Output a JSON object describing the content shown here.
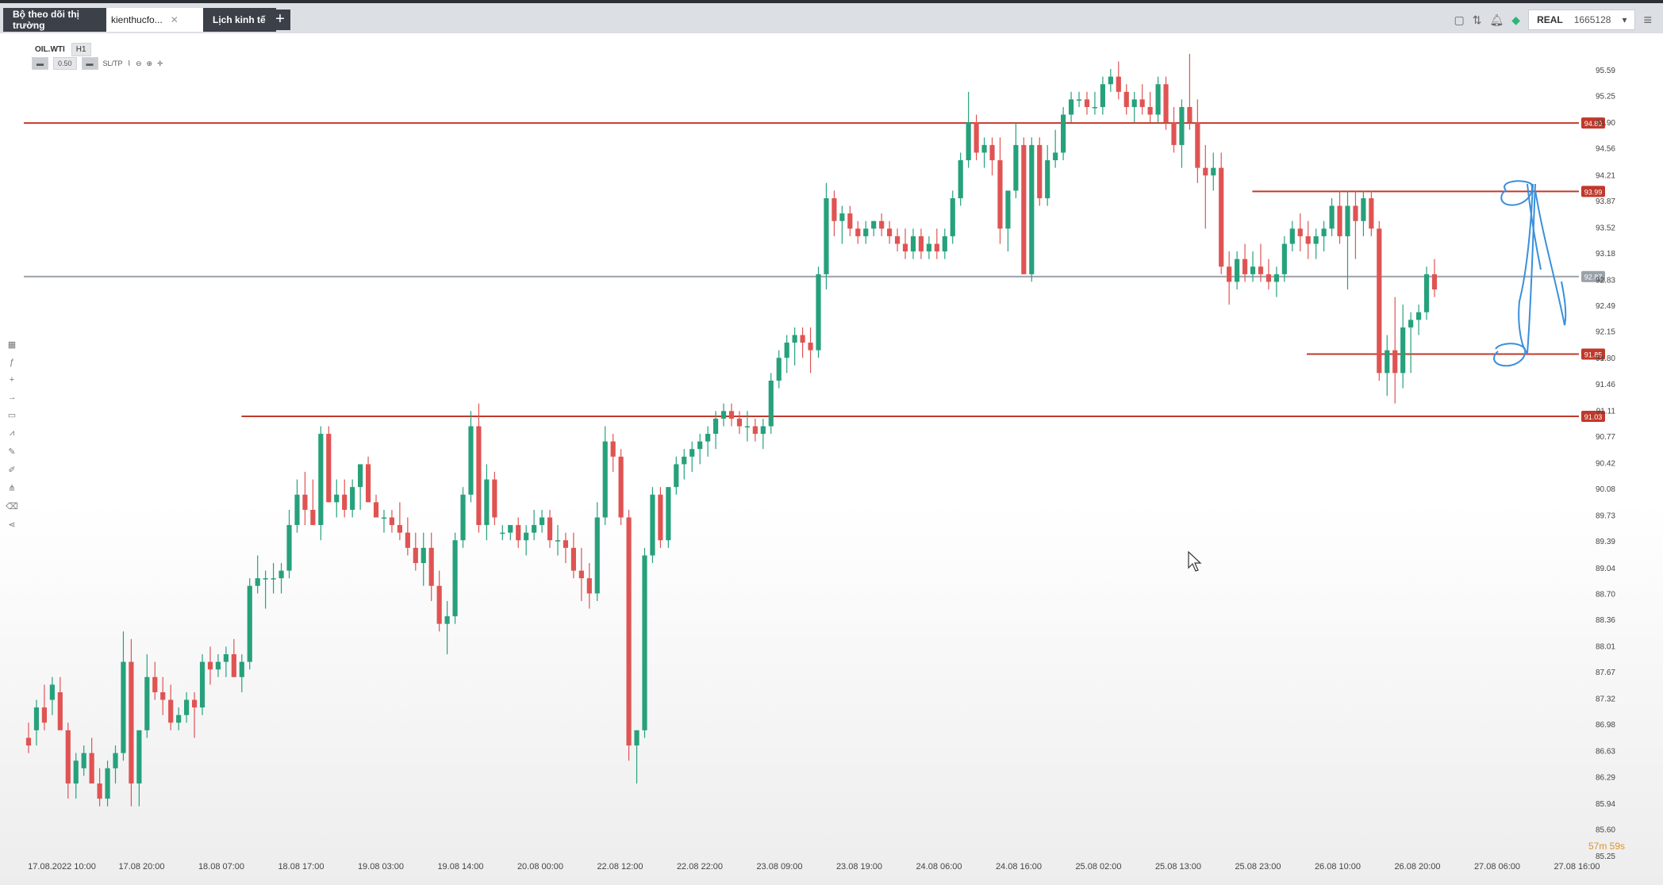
{
  "tabs": [
    {
      "label": "Bộ theo dõi thị trường",
      "kind": "dark"
    },
    {
      "label": "kienthucfo...",
      "kind": "light"
    },
    {
      "label": "Lịch kinh tế",
      "kind": "dark"
    }
  ],
  "account": {
    "mode": "REAL",
    "number": "1665128"
  },
  "symbol": {
    "name": "OIL.WTI",
    "timeframe": "H1",
    "volume": "0.50",
    "sltp": "SL/TP"
  },
  "timer": "57m 59s",
  "chart_data": {
    "type": "candlestick",
    "ylim": [
      85.25,
      95.59
    ],
    "price_ticks": [
      "95.59",
      "95.25",
      "94.90",
      "94.56",
      "94.21",
      "93.87",
      "93.52",
      "93.18",
      "92.83",
      "92.49",
      "92.15",
      "91.80",
      "91.46",
      "91.11",
      "90.77",
      "90.42",
      "90.08",
      "89.73",
      "89.39",
      "89.04",
      "88.70",
      "88.36",
      "88.01",
      "87.67",
      "87.32",
      "86.98",
      "86.63",
      "86.29",
      "85.94",
      "85.60",
      "85.25"
    ],
    "time_labels": [
      "17.08.2022 10:00",
      "17.08 20:00",
      "18.08 07:00",
      "18.08 17:00",
      "19.08 03:00",
      "19.08 14:00",
      "20.08 00:00",
      "22.08 12:00",
      "22.08 22:00",
      "23.08 09:00",
      "23.08 19:00",
      "24.08 06:00",
      "24.08 16:00",
      "25.08 02:00",
      "25.08 13:00",
      "25.08 23:00",
      "26.08 10:00",
      "26.08 20:00",
      "27.08 06:00",
      "27.08 16:00"
    ],
    "levels": [
      {
        "price": 94.89,
        "label": "94.89",
        "color": "#c0392b",
        "start": 0.0
      },
      {
        "price": 93.99,
        "label": "93.99",
        "color": "#c0392b",
        "start": 0.79
      },
      {
        "price": 92.87,
        "label": "92.87",
        "color": "#9aa1a9",
        "start": 0.0
      },
      {
        "price": 91.85,
        "label": "91.85",
        "color": "#c0392b",
        "start": 0.825
      },
      {
        "price": 91.03,
        "label": "91.03",
        "color": "#c0392b",
        "start": 0.14
      }
    ],
    "up_color": "#26a17b",
    "down_color": "#e05353",
    "candles": [
      [
        86.8,
        87.0,
        86.6,
        86.7
      ],
      [
        86.9,
        87.3,
        86.7,
        87.2
      ],
      [
        87.2,
        87.5,
        86.9,
        87.0
      ],
      [
        87.3,
        87.6,
        87.1,
        87.5
      ],
      [
        87.4,
        87.6,
        87.0,
        86.9
      ],
      [
        86.9,
        87.0,
        86.0,
        86.2
      ],
      [
        86.2,
        86.6,
        86.0,
        86.5
      ],
      [
        86.4,
        86.7,
        86.3,
        86.6
      ],
      [
        86.6,
        86.8,
        86.2,
        86.2
      ],
      [
        86.2,
        86.4,
        85.9,
        86.0
      ],
      [
        86.0,
        86.5,
        85.9,
        86.4
      ],
      [
        86.4,
        86.7,
        86.2,
        86.6
      ],
      [
        86.6,
        88.2,
        86.5,
        87.8
      ],
      [
        87.8,
        88.1,
        85.9,
        86.2
      ],
      [
        86.2,
        86.9,
        85.9,
        86.9
      ],
      [
        86.9,
        87.9,
        86.8,
        87.6
      ],
      [
        87.6,
        87.8,
        87.3,
        87.4
      ],
      [
        87.4,
        87.6,
        87.1,
        87.3
      ],
      [
        87.3,
        87.5,
        86.9,
        87.0
      ],
      [
        87.0,
        87.2,
        86.9,
        87.1
      ],
      [
        87.1,
        87.4,
        87.0,
        87.3
      ],
      [
        87.3,
        87.4,
        86.8,
        87.2
      ],
      [
        87.2,
        87.9,
        87.1,
        87.8
      ],
      [
        87.8,
        88.0,
        87.5,
        87.7
      ],
      [
        87.7,
        87.9,
        87.6,
        87.8
      ],
      [
        87.8,
        88.0,
        87.6,
        87.9
      ],
      [
        87.9,
        88.1,
        87.6,
        87.6
      ],
      [
        87.6,
        87.9,
        87.4,
        87.8
      ],
      [
        87.8,
        88.9,
        87.7,
        88.8
      ],
      [
        88.8,
        89.2,
        88.7,
        88.9
      ],
      [
        88.9,
        89.0,
        88.5,
        88.9
      ],
      [
        88.9,
        89.1,
        88.7,
        88.9
      ],
      [
        88.9,
        89.1,
        88.7,
        89.0
      ],
      [
        89.0,
        89.8,
        88.9,
        89.6
      ],
      [
        89.6,
        90.2,
        89.5,
        90.0
      ],
      [
        90.0,
        90.3,
        89.6,
        89.8
      ],
      [
        89.8,
        90.2,
        89.6,
        89.6
      ],
      [
        89.6,
        90.9,
        89.4,
        90.8
      ],
      [
        90.8,
        90.9,
        89.9,
        89.9
      ],
      [
        89.9,
        90.2,
        89.7,
        90.0
      ],
      [
        90.0,
        90.2,
        89.7,
        89.8
      ],
      [
        89.8,
        90.2,
        89.7,
        90.1
      ],
      [
        90.1,
        90.4,
        89.8,
        90.4
      ],
      [
        90.4,
        90.5,
        89.9,
        89.9
      ],
      [
        89.9,
        90.0,
        89.7,
        89.7
      ],
      [
        89.7,
        89.8,
        89.5,
        89.7
      ],
      [
        89.7,
        89.8,
        89.5,
        89.6
      ],
      [
        89.6,
        89.9,
        89.4,
        89.5
      ],
      [
        89.5,
        89.7,
        89.2,
        89.3
      ],
      [
        89.3,
        89.5,
        89.0,
        89.1
      ],
      [
        89.1,
        89.5,
        88.8,
        89.3
      ],
      [
        89.3,
        89.5,
        88.6,
        88.8
      ],
      [
        88.8,
        89.0,
        88.2,
        88.3
      ],
      [
        88.3,
        88.6,
        87.9,
        88.4
      ],
      [
        88.4,
        89.5,
        88.3,
        89.4
      ],
      [
        89.4,
        90.1,
        89.3,
        90.0
      ],
      [
        90.0,
        91.1,
        89.9,
        90.9
      ],
      [
        90.9,
        91.2,
        89.5,
        89.6
      ],
      [
        89.6,
        90.4,
        89.4,
        90.2
      ],
      [
        90.2,
        90.3,
        89.6,
        89.7
      ],
      [
        89.5,
        89.6,
        89.4,
        89.5
      ],
      [
        89.5,
        89.6,
        89.4,
        89.6
      ],
      [
        89.6,
        89.7,
        89.3,
        89.4
      ],
      [
        89.4,
        89.6,
        89.2,
        89.5
      ],
      [
        89.5,
        89.8,
        89.4,
        89.6
      ],
      [
        89.6,
        89.8,
        89.5,
        89.7
      ],
      [
        89.7,
        89.8,
        89.3,
        89.4
      ],
      [
        89.4,
        89.6,
        89.2,
        89.4
      ],
      [
        89.4,
        89.5,
        89.1,
        89.3
      ],
      [
        89.3,
        89.5,
        88.9,
        89.0
      ],
      [
        89.0,
        89.3,
        88.6,
        88.9
      ],
      [
        88.9,
        89.1,
        88.5,
        88.7
      ],
      [
        88.7,
        89.9,
        88.6,
        89.7
      ],
      [
        89.7,
        90.9,
        89.6,
        90.7
      ],
      [
        90.7,
        90.8,
        90.3,
        90.5
      ],
      [
        90.5,
        90.6,
        89.6,
        89.7
      ],
      [
        89.7,
        89.8,
        86.5,
        86.7
      ],
      [
        86.7,
        86.9,
        86.2,
        86.9
      ],
      [
        86.9,
        89.3,
        86.8,
        89.2
      ],
      [
        89.2,
        90.1,
        89.1,
        90.0
      ],
      [
        90.0,
        90.1,
        89.3,
        89.4
      ],
      [
        89.4,
        90.1,
        89.3,
        90.1
      ],
      [
        90.1,
        90.5,
        90.0,
        90.4
      ],
      [
        90.4,
        90.6,
        90.2,
        90.5
      ],
      [
        90.5,
        90.7,
        90.3,
        90.6
      ],
      [
        90.6,
        90.8,
        90.4,
        90.7
      ],
      [
        90.7,
        90.9,
        90.5,
        90.8
      ],
      [
        90.8,
        91.1,
        90.6,
        91.0
      ],
      [
        91.0,
        91.2,
        90.9,
        91.1
      ],
      [
        91.1,
        91.2,
        90.9,
        91.0
      ],
      [
        91.0,
        91.1,
        90.8,
        90.9
      ],
      [
        90.9,
        91.1,
        90.7,
        90.9
      ],
      [
        90.9,
        91.0,
        90.7,
        90.8
      ],
      [
        90.8,
        91.0,
        90.6,
        90.9
      ],
      [
        90.9,
        91.6,
        90.8,
        91.5
      ],
      [
        91.5,
        91.9,
        91.4,
        91.8
      ],
      [
        91.8,
        92.1,
        91.6,
        92.0
      ],
      [
        92.0,
        92.2,
        91.7,
        92.1
      ],
      [
        92.1,
        92.2,
        91.8,
        92.0
      ],
      [
        92.0,
        92.2,
        91.6,
        91.9
      ],
      [
        91.9,
        93.0,
        91.8,
        92.9
      ],
      [
        92.9,
        94.1,
        92.7,
        93.9
      ],
      [
        93.9,
        94.0,
        93.4,
        93.6
      ],
      [
        93.6,
        93.8,
        93.3,
        93.7
      ],
      [
        93.7,
        93.8,
        93.4,
        93.5
      ],
      [
        93.5,
        93.6,
        93.3,
        93.4
      ],
      [
        93.4,
        93.6,
        93.3,
        93.5
      ],
      [
        93.5,
        93.6,
        93.4,
        93.6
      ],
      [
        93.6,
        93.7,
        93.4,
        93.5
      ],
      [
        93.5,
        93.6,
        93.3,
        93.4
      ],
      [
        93.4,
        93.5,
        93.2,
        93.3
      ],
      [
        93.3,
        93.5,
        93.1,
        93.2
      ],
      [
        93.2,
        93.5,
        93.1,
        93.4
      ],
      [
        93.4,
        93.5,
        93.1,
        93.2
      ],
      [
        93.2,
        93.4,
        93.1,
        93.3
      ],
      [
        93.3,
        93.5,
        93.1,
        93.2
      ],
      [
        93.2,
        93.5,
        93.1,
        93.4
      ],
      [
        93.4,
        94.0,
        93.3,
        93.9
      ],
      [
        93.9,
        94.5,
        93.8,
        94.4
      ],
      [
        94.4,
        95.3,
        94.3,
        94.9
      ],
      [
        94.9,
        95.0,
        94.4,
        94.5
      ],
      [
        94.5,
        94.7,
        94.3,
        94.6
      ],
      [
        94.6,
        94.7,
        94.2,
        94.4
      ],
      [
        94.4,
        94.7,
        93.3,
        93.5
      ],
      [
        93.5,
        94.0,
        93.2,
        94.0
      ],
      [
        94.0,
        94.9,
        93.9,
        94.6
      ],
      [
        94.6,
        94.7,
        92.9,
        92.9
      ],
      [
        92.9,
        94.7,
        92.8,
        94.6
      ],
      [
        94.6,
        94.7,
        93.8,
        93.9
      ],
      [
        93.9,
        94.6,
        93.8,
        94.4
      ],
      [
        94.4,
        94.8,
        94.3,
        94.5
      ],
      [
        94.5,
        95.1,
        94.4,
        95.0
      ],
      [
        95.0,
        95.3,
        94.9,
        95.2
      ],
      [
        95.2,
        95.3,
        95.1,
        95.2
      ],
      [
        95.2,
        95.3,
        95.0,
        95.1
      ],
      [
        95.1,
        95.3,
        95.0,
        95.1
      ],
      [
        95.1,
        95.5,
        95.0,
        95.4
      ],
      [
        95.4,
        95.6,
        95.3,
        95.5
      ],
      [
        95.5,
        95.7,
        95.2,
        95.3
      ],
      [
        95.3,
        95.4,
        95.0,
        95.1
      ],
      [
        95.1,
        95.3,
        94.9,
        95.2
      ],
      [
        95.2,
        95.4,
        95.0,
        95.1
      ],
      [
        95.1,
        95.3,
        94.9,
        95.0
      ],
      [
        95.0,
        95.5,
        94.9,
        95.4
      ],
      [
        95.4,
        95.5,
        94.8,
        94.9
      ],
      [
        94.9,
        95.1,
        94.5,
        94.6
      ],
      [
        94.6,
        95.2,
        94.3,
        95.1
      ],
      [
        95.1,
        95.8,
        94.8,
        94.9
      ],
      [
        94.9,
        95.2,
        94.1,
        94.3
      ],
      [
        94.3,
        94.6,
        93.5,
        94.2
      ],
      [
        94.2,
        94.5,
        94.0,
        94.3
      ],
      [
        94.3,
        94.5,
        92.9,
        93.0
      ],
      [
        93.0,
        93.2,
        92.5,
        92.8
      ],
      [
        92.8,
        93.2,
        92.7,
        93.1
      ],
      [
        93.1,
        93.3,
        92.8,
        92.9
      ],
      [
        92.9,
        93.2,
        92.8,
        93.0
      ],
      [
        93.0,
        93.3,
        92.8,
        92.9
      ],
      [
        92.9,
        93.1,
        92.7,
        92.8
      ],
      [
        92.8,
        93.0,
        92.6,
        92.9
      ],
      [
        92.9,
        93.4,
        92.8,
        93.3
      ],
      [
        93.3,
        93.6,
        93.2,
        93.5
      ],
      [
        93.5,
        93.7,
        93.2,
        93.4
      ],
      [
        93.4,
        93.6,
        93.1,
        93.3
      ],
      [
        93.3,
        93.5,
        93.1,
        93.4
      ],
      [
        93.4,
        93.6,
        93.2,
        93.5
      ],
      [
        93.5,
        93.9,
        93.4,
        93.8
      ],
      [
        93.8,
        94.0,
        93.3,
        93.4
      ],
      [
        93.4,
        94.0,
        92.7,
        93.8
      ],
      [
        93.8,
        94.0,
        93.1,
        93.6
      ],
      [
        93.6,
        94.0,
        93.4,
        93.9
      ],
      [
        93.9,
        94.0,
        93.4,
        93.5
      ],
      [
        93.5,
        93.6,
        91.5,
        91.6
      ],
      [
        91.6,
        92.1,
        91.3,
        91.9
      ],
      [
        91.9,
        92.6,
        91.2,
        91.6
      ],
      [
        91.6,
        92.5,
        91.4,
        92.2
      ],
      [
        92.2,
        92.4,
        91.6,
        92.3
      ],
      [
        92.3,
        92.5,
        92.1,
        92.4
      ],
      [
        92.4,
        93.0,
        92.3,
        92.9
      ],
      [
        92.9,
        93.1,
        92.6,
        92.7
      ]
    ],
    "annotation": {
      "kind": "hand-drawn",
      "color": "#3a8fdc"
    }
  }
}
